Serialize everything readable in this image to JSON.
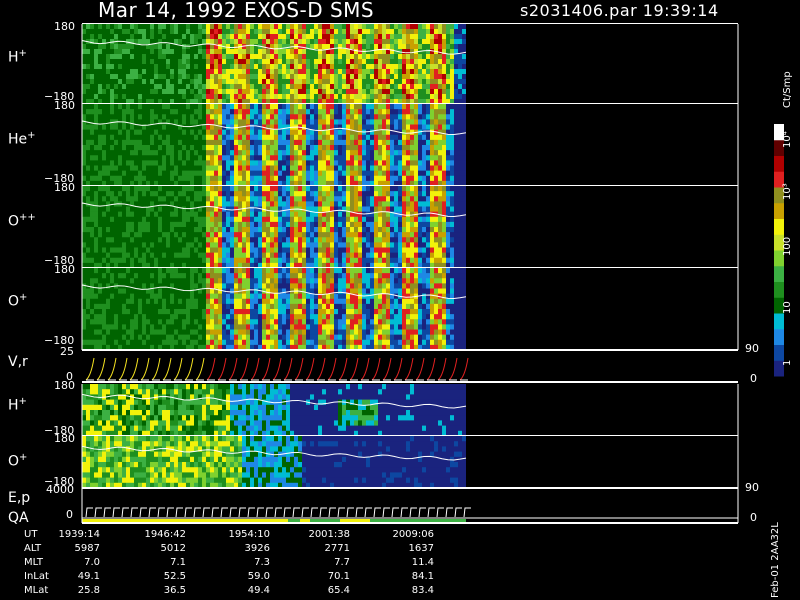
{
  "header": {
    "title": "Mar 14, 1992    EXOS-D SMS",
    "file": "s2031406.par  19:39:14"
  },
  "colors": {
    "background": "#000000",
    "colorbar": [
      "#1a237e",
      "#0d47a1",
      "#1e88e5",
      "#00bcd4",
      "#006400",
      "#1f8f1f",
      "#3cb043",
      "#7fd12f",
      "#c8e02a",
      "#f2f20a",
      "#c8a000",
      "#8f8f1f",
      "#e02020",
      "#b00000",
      "#600000",
      "#ffffff"
    ]
  },
  "panels": {
    "h_plus": {
      "name": "H",
      "sup": "+",
      "top": "180",
      "bottom": "−180"
    },
    "he_plus": {
      "name": "He",
      "sup": "+",
      "top": "180",
      "bottom": "−180"
    },
    "o_plusplus": {
      "name": "O",
      "sup": "++",
      "top": "180",
      "bottom": "−180"
    },
    "o_plus": {
      "name": "O",
      "sup": "+",
      "top": "180",
      "bottom": "−180"
    },
    "vr": {
      "name": "V,r",
      "top": "25",
      "bottom": "0",
      "right_top": "90",
      "right_bottom": "0"
    },
    "h_plus_2": {
      "name": "H",
      "sup": "+",
      "top": "180",
      "bottom": "−180"
    },
    "o_plus_2": {
      "name": "O",
      "sup": "+",
      "top": "180",
      "bottom": "−180"
    },
    "ep": {
      "name": "E,p",
      "top": "4000",
      "bottom": "0",
      "right_top": "90",
      "right_bottom": "0"
    },
    "qa": {
      "name": "QA"
    }
  },
  "colorbar": {
    "unit": "Ct/Smp",
    "labels": [
      "10⁴",
      "10³",
      "100",
      "10",
      "1"
    ],
    "decades": [
      4,
      3,
      2,
      1,
      0
    ]
  },
  "table": {
    "rows": [
      "UT",
      "ALT",
      "MLT",
      "InLat",
      "MLat"
    ],
    "columns": [
      {
        "UT": "1939:14",
        "ALT": "5987",
        "MLT": "7.0",
        "InLat": "49.1",
        "MLat": "25.8"
      },
      {
        "UT": "1946:42",
        "ALT": "5012",
        "MLT": "7.1",
        "InLat": "52.5",
        "MLat": "36.5"
      },
      {
        "UT": "1954:10",
        "ALT": "3926",
        "MLT": "7.3",
        "InLat": "59.0",
        "MLat": "49.4"
      },
      {
        "UT": "2001:38",
        "ALT": "2771",
        "MLT": "7.7",
        "InLat": "70.1",
        "MLat": "65.4"
      },
      {
        "UT": "2009:06",
        "ALT": "1637",
        "MLT": "11.4",
        "InLat": "84.1",
        "MLat": "83.4"
      }
    ]
  },
  "footer": {
    "stamp": "Feb-01 2AA32L"
  },
  "chart_data": {
    "type": "heatmap",
    "title": "Mar 14, 1992    EXOS-D SMS",
    "x_ticks": [
      "1939:14",
      "1946:42",
      "1954:10",
      "2001:38",
      "2009:06"
    ],
    "panels": [
      "H+",
      "He+",
      "O++",
      "O+",
      "V,r",
      "H+",
      "O+",
      "E,p",
      "QA"
    ],
    "pitch_angle_range": [
      -180,
      180
    ],
    "vr_range": [
      0,
      25
    ],
    "ep_range": [
      0,
      4000
    ],
    "colorbar_unit": "Ct/Smp",
    "colorbar_range_decades": [
      0,
      4
    ],
    "colorbar_scale": "log"
  }
}
